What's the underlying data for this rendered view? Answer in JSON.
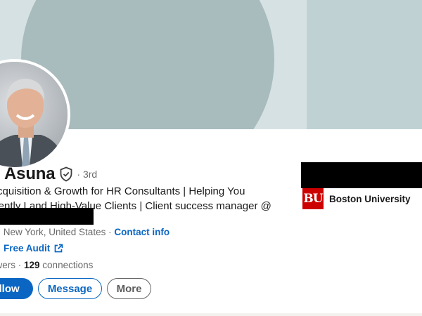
{
  "profile": {
    "name": "n Asuna",
    "degree": "· 3rd",
    "headline_line1": "Acquisition & Growth for HR Consultants | Helping You",
    "headline_line2": "stently Land High-Value Clients | Client success manager @",
    "location": "rk, New York, United States",
    "location_separator": " · ",
    "contact_info_label": "Contact info",
    "website_label": "Free Audit",
    "followers_label": "owers",
    "stats_separator": " · ",
    "connections_count": "129",
    "connections_label": " connections"
  },
  "education": {
    "logo_text": "BU",
    "name": "Boston University"
  },
  "actions": {
    "follow_label": "ollow",
    "message_label": "Message",
    "more_label": "More"
  },
  "icons": {
    "verified": "shield-check-icon",
    "external": "external-link-icon"
  },
  "colors": {
    "brand_blue": "#0a66c2",
    "banner_light": "#d5e1e3",
    "banner_dark": "#a8bbbd",
    "bu_red": "#cc0000"
  }
}
